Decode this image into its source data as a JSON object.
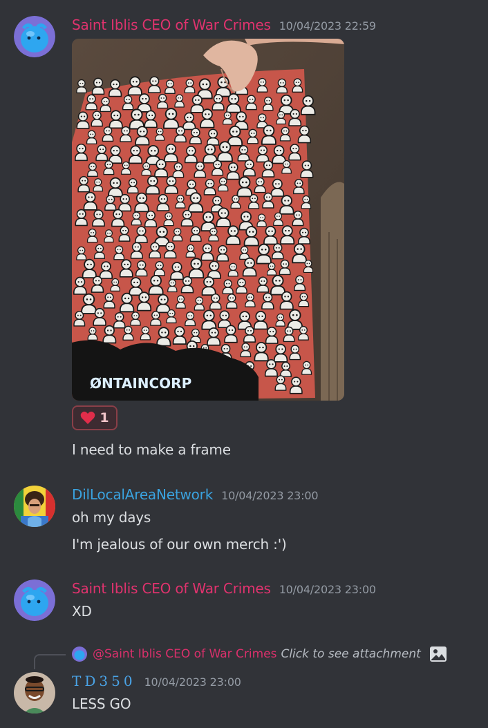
{
  "messages": [
    {
      "username": "Saint Iblis CEO of War Crimes",
      "username_color": "#e0336e",
      "timestamp": "10/04/2023 22:59",
      "attachment": {
        "banner_text": "NTAINCORP",
        "banner_glyph": "Ø"
      },
      "reaction": {
        "emoji": "heart-icon",
        "count": "1"
      },
      "text": "I need to make a frame"
    },
    {
      "username": "DilLocalAreaNetwork",
      "username_color": "#3aa3e0",
      "timestamp": "10/04/2023 23:00",
      "lines": [
        "oh my days",
        "I'm jealous of our own merch :')"
      ]
    },
    {
      "username": "Saint Iblis CEO of War Crimes",
      "username_color": "#e0336e",
      "timestamp": "10/04/2023 23:00",
      "text": "XD"
    },
    {
      "reply": {
        "mention": "@Saint Iblis CEO of War Crimes",
        "preview": "Click to see attachment",
        "icon": "image-icon"
      },
      "username": "TD350",
      "username_color": "#4aa3e6",
      "timestamp": "10/04/2023 23:00",
      "text": "LESS GO"
    }
  ]
}
